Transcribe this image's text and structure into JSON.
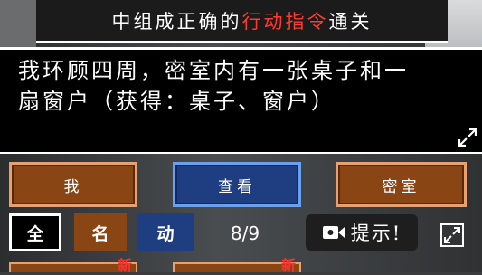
{
  "banner": {
    "prefix": "中组成正确的",
    "highlight": "行动指令",
    "suffix": "通关"
  },
  "story": {
    "line1": "我环顾四周，密室内有一张桌子和一",
    "line2": "扇窗户（获得：桌子、窗户）"
  },
  "commands": [
    {
      "label": "我",
      "style": "brown"
    },
    {
      "label": "查看",
      "style": "blue"
    },
    {
      "label": "密室",
      "style": "brown"
    }
  ],
  "filters": {
    "all": "全",
    "name": "名",
    "verb": "动"
  },
  "progress": {
    "text": "8/9",
    "current": 8,
    "total": 9
  },
  "hint": {
    "label": "提示!"
  },
  "badges": {
    "new_left": "新",
    "new_right": "新"
  },
  "colors": {
    "highlight": "#ff3b30",
    "brown": "#8a4515",
    "blue": "#1f3e82"
  }
}
